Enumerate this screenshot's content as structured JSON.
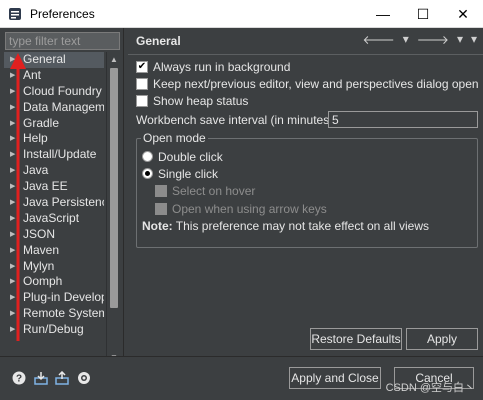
{
  "window": {
    "title": "Preferences",
    "minimize": "—",
    "maximize": "☐",
    "close": "✕"
  },
  "left_panel": {
    "filter_placeholder": "type filter text",
    "items": [
      {
        "label": "General",
        "selected": true
      },
      {
        "label": "Ant"
      },
      {
        "label": "Cloud Foundry"
      },
      {
        "label": "Data Management"
      },
      {
        "label": "Gradle"
      },
      {
        "label": "Help"
      },
      {
        "label": "Install/Update"
      },
      {
        "label": "Java"
      },
      {
        "label": "Java EE"
      },
      {
        "label": "Java Persistence"
      },
      {
        "label": "JavaScript"
      },
      {
        "label": "JSON"
      },
      {
        "label": "Maven"
      },
      {
        "label": "Mylyn"
      },
      {
        "label": "Oomph"
      },
      {
        "label": "Plug-in Development"
      },
      {
        "label": "Remote Systems"
      },
      {
        "label": "Run/Debug"
      }
    ]
  },
  "header": {
    "title": "General",
    "back": "🡐",
    "back_menu": "▾",
    "forward": "🡒",
    "forward_menu": "▾",
    "view_menu": "▾"
  },
  "options": {
    "always_run": {
      "label": "Always run in background",
      "checked": true
    },
    "keep_next_prev": {
      "label": "Keep next/previous editor, view and perspectives dialog open",
      "checked": false
    },
    "show_heap": {
      "label": "Show heap status",
      "checked": false
    },
    "save_interval_label": "Workbench save interval (in minutes):",
    "save_interval_value": "5"
  },
  "open_mode": {
    "title": "Open mode",
    "double_click": "Double click",
    "single_click": "Single click",
    "select_on_hover": "Select on hover",
    "open_with_arrows": "Open when using arrow keys",
    "note_bold": "Note:",
    "note_text": " This preference may not take effect on all views"
  },
  "buttons": {
    "restore_defaults": "Restore Defaults",
    "apply": "Apply",
    "apply_and_close": "Apply and Close",
    "cancel": "Cancel"
  },
  "watermark": "CSDN @空与白丶",
  "colors": {
    "background": "#3c3f41",
    "annotation_arrow": "#e0201f"
  }
}
